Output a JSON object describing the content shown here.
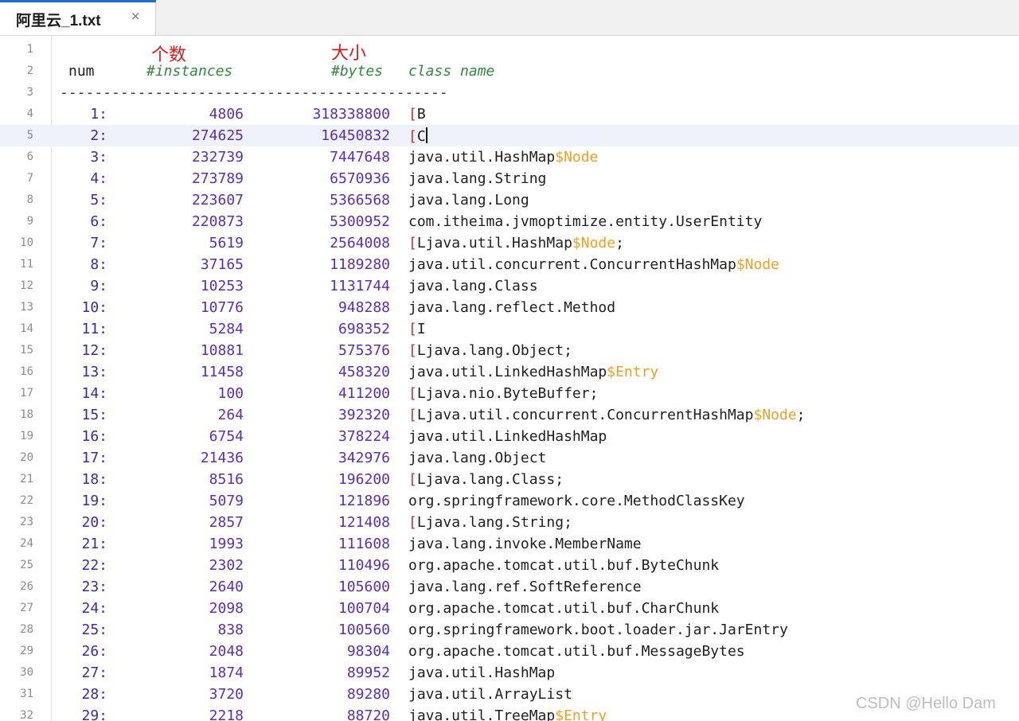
{
  "tab": {
    "title": "阿里云_1.txt",
    "close": "×"
  },
  "annotations": {
    "count_label": "个数",
    "size_label": "大小"
  },
  "header": {
    "num": "num",
    "instances": "#instances",
    "bytes": "#bytes",
    "class_name": "class name"
  },
  "separator": "---------------------------------------------",
  "line_numbers": [
    "1",
    "2",
    "3",
    "4",
    "5",
    "6",
    "7",
    "8",
    "9",
    "10",
    "11",
    "12",
    "13",
    "14",
    "15",
    "16",
    "17",
    "18",
    "19",
    "20",
    "21",
    "22",
    "23",
    "24",
    "25",
    "26",
    "27",
    "28",
    "29",
    "30",
    "31",
    "32"
  ],
  "rows": [
    {
      "num": "1:",
      "instances": "4806",
      "bytes": "318338800",
      "prefix": "[",
      "cls": "B",
      "suffix": "",
      "tail": ""
    },
    {
      "num": "2:",
      "instances": "274625",
      "bytes": "16450832",
      "prefix": "[",
      "cls": "C",
      "suffix": "",
      "tail": ""
    },
    {
      "num": "3:",
      "instances": "232739",
      "bytes": "7447648",
      "prefix": "",
      "cls": "java.util.HashMap",
      "suffix": "$Node",
      "tail": ""
    },
    {
      "num": "4:",
      "instances": "273789",
      "bytes": "6570936",
      "prefix": "",
      "cls": "java.lang.String",
      "suffix": "",
      "tail": ""
    },
    {
      "num": "5:",
      "instances": "223607",
      "bytes": "5366568",
      "prefix": "",
      "cls": "java.lang.Long",
      "suffix": "",
      "tail": ""
    },
    {
      "num": "6:",
      "instances": "220873",
      "bytes": "5300952",
      "prefix": "",
      "cls": "com.itheima.jvmoptimize.entity.UserEntity",
      "suffix": "",
      "tail": ""
    },
    {
      "num": "7:",
      "instances": "5619",
      "bytes": "2564008",
      "prefix": "[",
      "cls": "Ljava.util.HashMap",
      "suffix": "$Node",
      "tail": ";"
    },
    {
      "num": "8:",
      "instances": "37165",
      "bytes": "1189280",
      "prefix": "",
      "cls": "java.util.concurrent.ConcurrentHashMap",
      "suffix": "$Node",
      "tail": ""
    },
    {
      "num": "9:",
      "instances": "10253",
      "bytes": "1131744",
      "prefix": "",
      "cls": "java.lang.Class",
      "suffix": "",
      "tail": ""
    },
    {
      "num": "10:",
      "instances": "10776",
      "bytes": "948288",
      "prefix": "",
      "cls": "java.lang.reflect.Method",
      "suffix": "",
      "tail": ""
    },
    {
      "num": "11:",
      "instances": "5284",
      "bytes": "698352",
      "prefix": "[",
      "cls": "I",
      "suffix": "",
      "tail": ""
    },
    {
      "num": "12:",
      "instances": "10881",
      "bytes": "575376",
      "prefix": "[",
      "cls": "Ljava.lang.Object;",
      "suffix": "",
      "tail": ""
    },
    {
      "num": "13:",
      "instances": "11458",
      "bytes": "458320",
      "prefix": "",
      "cls": "java.util.LinkedHashMap",
      "suffix": "$Entry",
      "tail": ""
    },
    {
      "num": "14:",
      "instances": "100",
      "bytes": "411200",
      "prefix": "[",
      "cls": "Ljava.nio.ByteBuffer;",
      "suffix": "",
      "tail": ""
    },
    {
      "num": "15:",
      "instances": "264",
      "bytes": "392320",
      "prefix": "[",
      "cls": "Ljava.util.concurrent.ConcurrentHashMap",
      "suffix": "$Node",
      "tail": ";"
    },
    {
      "num": "16:",
      "instances": "6754",
      "bytes": "378224",
      "prefix": "",
      "cls": "java.util.LinkedHashMap",
      "suffix": "",
      "tail": ""
    },
    {
      "num": "17:",
      "instances": "21436",
      "bytes": "342976",
      "prefix": "",
      "cls": "java.lang.Object",
      "suffix": "",
      "tail": ""
    },
    {
      "num": "18:",
      "instances": "8516",
      "bytes": "196200",
      "prefix": "[",
      "cls": "Ljava.lang.Class;",
      "suffix": "",
      "tail": ""
    },
    {
      "num": "19:",
      "instances": "5079",
      "bytes": "121896",
      "prefix": "",
      "cls": "org.springframework.core.MethodClassKey",
      "suffix": "",
      "tail": ""
    },
    {
      "num": "20:",
      "instances": "2857",
      "bytes": "121408",
      "prefix": "[",
      "cls": "Ljava.lang.String;",
      "suffix": "",
      "tail": ""
    },
    {
      "num": "21:",
      "instances": "1993",
      "bytes": "111608",
      "prefix": "",
      "cls": "java.lang.invoke.MemberName",
      "suffix": "",
      "tail": ""
    },
    {
      "num": "22:",
      "instances": "2302",
      "bytes": "110496",
      "prefix": "",
      "cls": "org.apache.tomcat.util.buf.ByteChunk",
      "suffix": "",
      "tail": ""
    },
    {
      "num": "23:",
      "instances": "2640",
      "bytes": "105600",
      "prefix": "",
      "cls": "java.lang.ref.SoftReference",
      "suffix": "",
      "tail": ""
    },
    {
      "num": "24:",
      "instances": "2098",
      "bytes": "100704",
      "prefix": "",
      "cls": "org.apache.tomcat.util.buf.CharChunk",
      "suffix": "",
      "tail": ""
    },
    {
      "num": "25:",
      "instances": "838",
      "bytes": "100560",
      "prefix": "",
      "cls": "org.springframework.boot.loader.jar.JarEntry",
      "suffix": "",
      "tail": ""
    },
    {
      "num": "26:",
      "instances": "2048",
      "bytes": "98304",
      "prefix": "",
      "cls": "org.apache.tomcat.util.buf.MessageBytes",
      "suffix": "",
      "tail": ""
    },
    {
      "num": "27:",
      "instances": "1874",
      "bytes": "89952",
      "prefix": "",
      "cls": "java.util.HashMap",
      "suffix": "",
      "tail": ""
    },
    {
      "num": "28:",
      "instances": "3720",
      "bytes": "89280",
      "prefix": "",
      "cls": "java.util.ArrayList",
      "suffix": "",
      "tail": ""
    },
    {
      "num": "29:",
      "instances": "2218",
      "bytes": "88720",
      "prefix": "",
      "cls": "java.util.TreeMap",
      "suffix": "$Entry",
      "tail": ""
    }
  ],
  "watermark": "CSDN @Hello Dam",
  "colors": {
    "bracket": "#d03030",
    "dollar_suffix": "#f0a020",
    "header_green": "#2e8b3d",
    "numbers": "#5b2db8",
    "annotation_red": "#e01818",
    "tab_accent": "#1a6fdb"
  }
}
